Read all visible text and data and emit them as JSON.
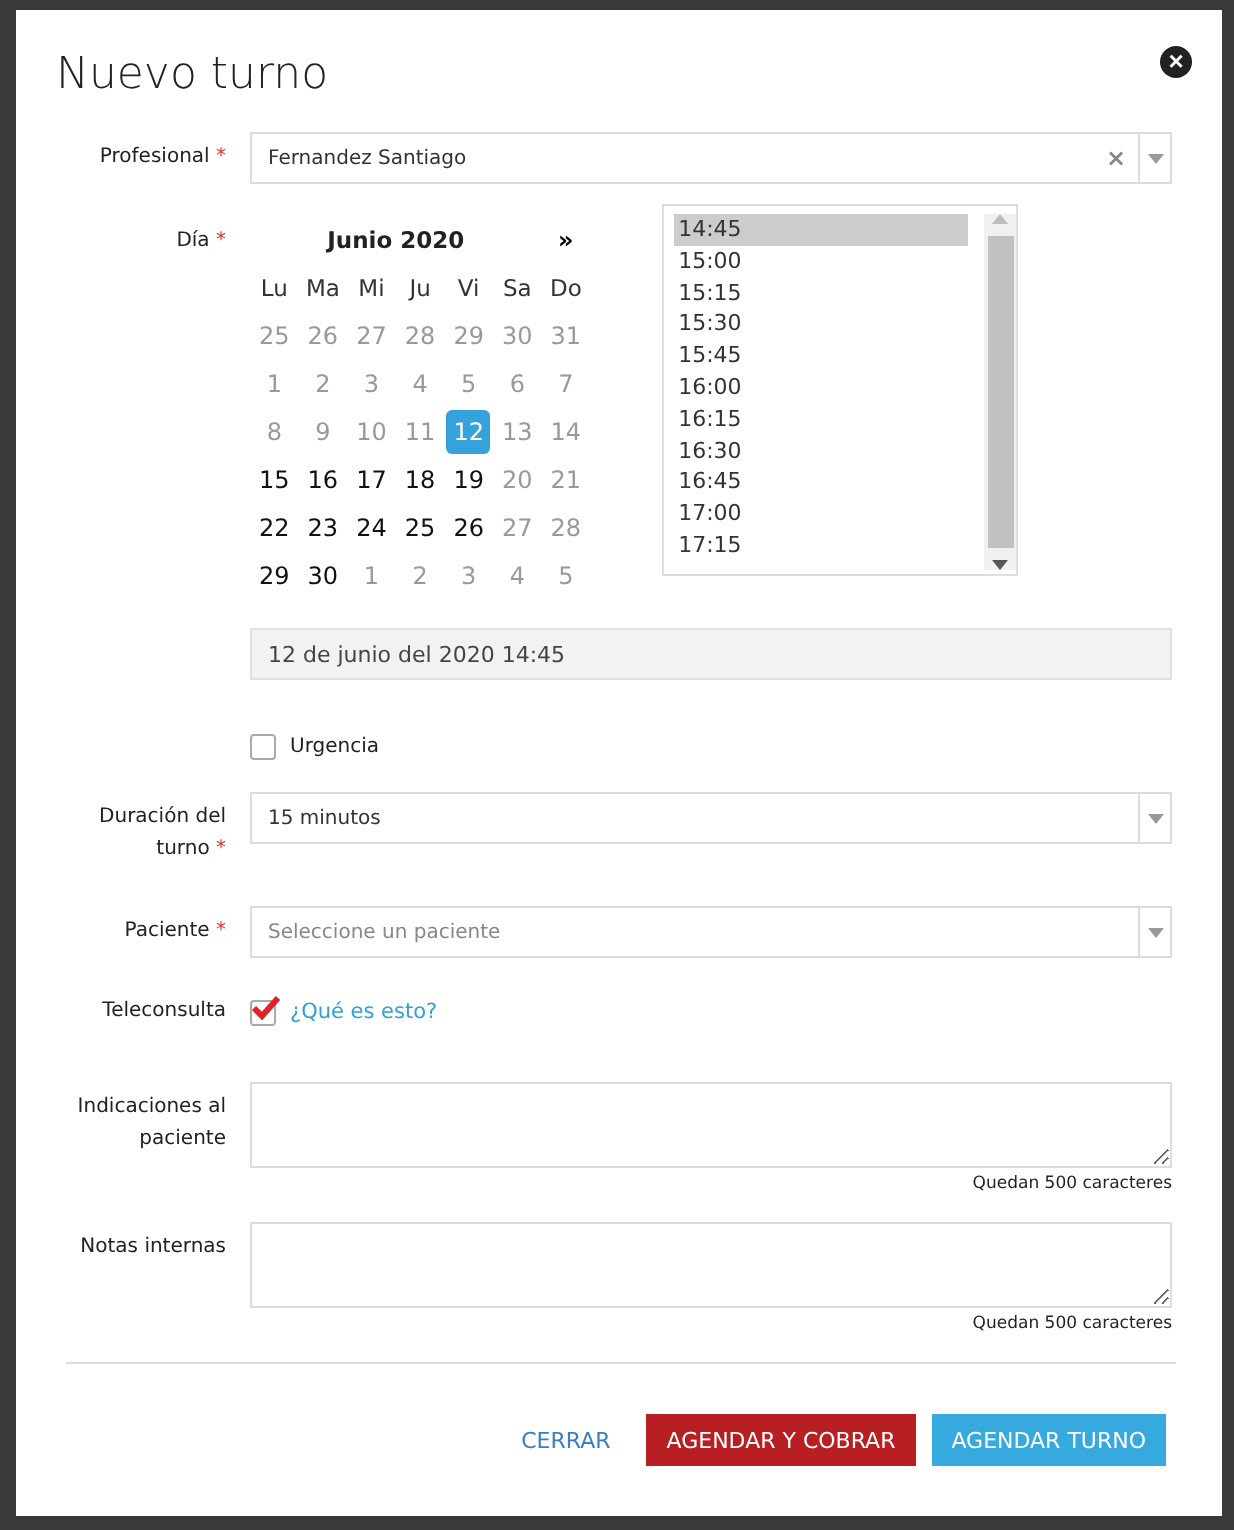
{
  "dialog": {
    "title": "Nuevo turno",
    "close": "×"
  },
  "profesional": {
    "label": "Profesional",
    "required": "*",
    "value": "Fernandez Santiago",
    "clear": "×"
  },
  "dia": {
    "label": "Día",
    "required": "*",
    "calendar": {
      "month": "Junio 2020",
      "next": "»",
      "weekdays": [
        "Lu",
        "Ma",
        "Mi",
        "Ju",
        "Vi",
        "Sa",
        "Do"
      ],
      "weeks": [
        [
          {
            "day": "25",
            "enabled": false,
            "selected": false
          },
          {
            "day": "26",
            "enabled": false,
            "selected": false
          },
          {
            "day": "27",
            "enabled": false,
            "selected": false
          },
          {
            "day": "28",
            "enabled": false,
            "selected": false
          },
          {
            "day": "29",
            "enabled": false,
            "selected": false
          },
          {
            "day": "30",
            "enabled": false,
            "selected": false
          },
          {
            "day": "31",
            "enabled": false,
            "selected": false
          }
        ],
        [
          {
            "day": "1",
            "enabled": false,
            "selected": false
          },
          {
            "day": "2",
            "enabled": false,
            "selected": false
          },
          {
            "day": "3",
            "enabled": false,
            "selected": false
          },
          {
            "day": "4",
            "enabled": false,
            "selected": false
          },
          {
            "day": "5",
            "enabled": false,
            "selected": false
          },
          {
            "day": "6",
            "enabled": false,
            "selected": false
          },
          {
            "day": "7",
            "enabled": false,
            "selected": false
          }
        ],
        [
          {
            "day": "8",
            "enabled": false,
            "selected": false
          },
          {
            "day": "9",
            "enabled": false,
            "selected": false
          },
          {
            "day": "10",
            "enabled": false,
            "selected": false
          },
          {
            "day": "11",
            "enabled": false,
            "selected": false
          },
          {
            "day": "12",
            "enabled": true,
            "selected": true
          },
          {
            "day": "13",
            "enabled": false,
            "selected": false
          },
          {
            "day": "14",
            "enabled": false,
            "selected": false
          }
        ],
        [
          {
            "day": "15",
            "enabled": true,
            "selected": false
          },
          {
            "day": "16",
            "enabled": true,
            "selected": false
          },
          {
            "day": "17",
            "enabled": true,
            "selected": false
          },
          {
            "day": "18",
            "enabled": true,
            "selected": false
          },
          {
            "day": "19",
            "enabled": true,
            "selected": false
          },
          {
            "day": "20",
            "enabled": false,
            "selected": false
          },
          {
            "day": "21",
            "enabled": false,
            "selected": false
          }
        ],
        [
          {
            "day": "22",
            "enabled": true,
            "selected": false
          },
          {
            "day": "23",
            "enabled": true,
            "selected": false
          },
          {
            "day": "24",
            "enabled": true,
            "selected": false
          },
          {
            "day": "25",
            "enabled": true,
            "selected": false
          },
          {
            "day": "26",
            "enabled": true,
            "selected": false
          },
          {
            "day": "27",
            "enabled": false,
            "selected": false
          },
          {
            "day": "28",
            "enabled": false,
            "selected": false
          }
        ],
        [
          {
            "day": "29",
            "enabled": true,
            "selected": false
          },
          {
            "day": "30",
            "enabled": true,
            "selected": false
          },
          {
            "day": "1",
            "enabled": false,
            "selected": false
          },
          {
            "day": "2",
            "enabled": false,
            "selected": false
          },
          {
            "day": "3",
            "enabled": false,
            "selected": false
          },
          {
            "day": "4",
            "enabled": false,
            "selected": false
          },
          {
            "day": "5",
            "enabled": false,
            "selected": false
          }
        ]
      ]
    },
    "times": [
      {
        "label": "14:45",
        "selected": true
      },
      {
        "label": "15:00",
        "selected": false
      },
      {
        "label": "15:15",
        "selected": false
      },
      {
        "label": "15:30",
        "selected": false
      },
      {
        "label": "15:45",
        "selected": false
      },
      {
        "label": "16:00",
        "selected": false
      },
      {
        "label": "16:15",
        "selected": false
      },
      {
        "label": "16:30",
        "selected": false
      },
      {
        "label": "16:45",
        "selected": false
      },
      {
        "label": "17:00",
        "selected": false
      },
      {
        "label": "17:15",
        "selected": false
      }
    ],
    "summary": "12 de junio del 2020 14:45"
  },
  "urgencia": {
    "label": "Urgencia",
    "checked": false
  },
  "duracion": {
    "label": "Duración del turno",
    "required": "*",
    "value": "15 minutos"
  },
  "paciente": {
    "label": "Paciente",
    "required": "*",
    "placeholder": "Seleccione un paciente"
  },
  "teleconsulta": {
    "label": "Teleconsulta",
    "checked": true,
    "link": "¿Qué es esto?"
  },
  "indicaciones": {
    "label": "Indicaciones al paciente",
    "counter": "Quedan 500 caracteres"
  },
  "notas": {
    "label": "Notas internas",
    "counter": "Quedan 500 caracteres"
  },
  "buttons": [
    {
      "label": "CERRAR",
      "kind": "link"
    },
    {
      "label": "AGENDAR Y COBRAR",
      "kind": "danger"
    },
    {
      "label": "AGENDAR TURNO",
      "kind": "primary"
    }
  ]
}
